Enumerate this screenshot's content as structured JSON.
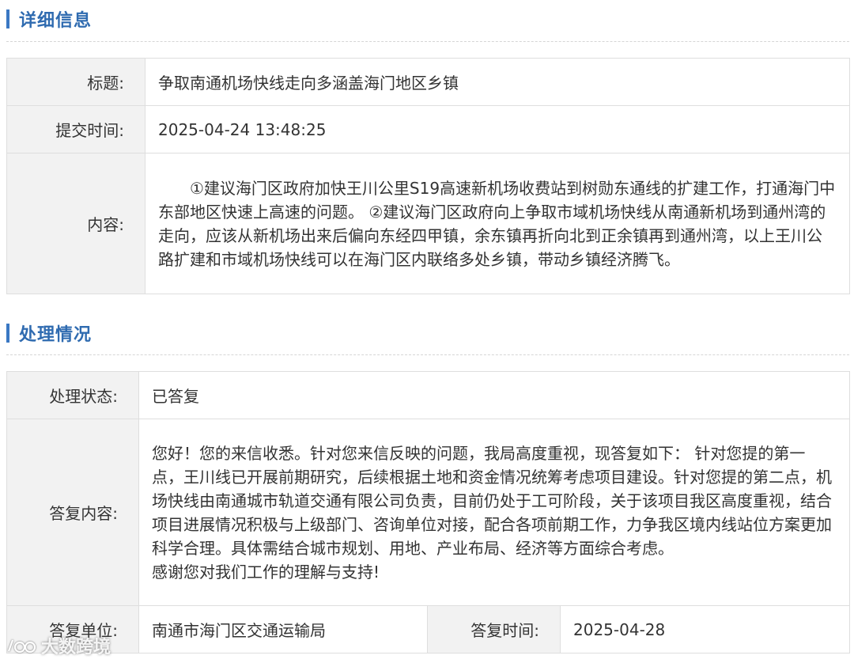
{
  "detail": {
    "section_title": "详细信息",
    "title_label": "标题:",
    "title_value": "争取南通机场快线走向多涵盖海门地区乡镇",
    "time_label": "提交时间:",
    "time_value": "2025-04-24 13:48:25",
    "content_label": "内容:",
    "content_value": "①建议海门区政府加快王川公里S19高速新机场收费站到树勋东通线的扩建工作，打通海门中东部地区快速上高速的问题。  ②建议海门区政府向上争取市域机场快线从南通新机场到通州湾的走向，应该从新机场出来后偏向东经四甲镇，余东镇再折向北到正余镇再到通州湾，以上王川公路扩建和市域机场快线可以在海门区内联络多处乡镇，带动乡镇经济腾飞。"
  },
  "processing": {
    "section_title": "处理情况",
    "status_label": "处理状态:",
    "status_value": "已答复",
    "reply_label": "答复内容:",
    "reply_line1": "您好！您的来信收悉。针对您来信反映的问题，我局高度重视，现答复如下： 针对您提的第一点，王川线已开展前期研究，后续根据土地和资金情况统筹考虑项目建设。针对您提的第二点，机场快线由南通城市轨道交通有限公司负责，目前仍处于工可阶段，关于该项目我区高度重视，结合项目进展情况积极与上级部门、咨询单位对接，配合各项前期工作，力争我区境内线站位方案更加科学合理。具体需结合城市规划、用地、产业布局、经济等方面综合考虑。",
    "reply_line2": "感谢您对我们工作的理解与支持!",
    "unit_label": "答复单位:",
    "unit_value": "南通市海门区交通运输局",
    "reply_time_label": "答复时间:",
    "reply_time_value": "2025-04-28"
  },
  "watermark": {
    "text": "大数跨境",
    "icon": "logo-icon"
  },
  "colors": {
    "accent": "#3a78c3",
    "label_bg": "#f2f2f2",
    "border": "#dedede"
  }
}
